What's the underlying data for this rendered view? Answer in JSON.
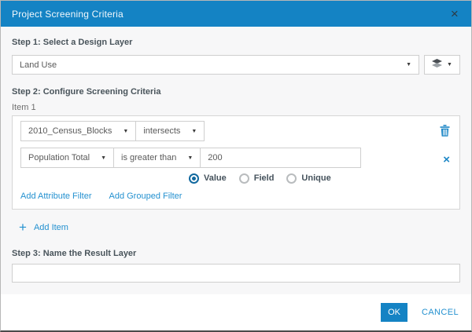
{
  "dialog": {
    "title": "Project Screening Criteria"
  },
  "icons": {
    "close": "×",
    "caret": "▼",
    "plus": "+",
    "remove": "×"
  },
  "step1": {
    "label": "Step 1: Select a Design Layer",
    "design_layer_value": "Land Use"
  },
  "step2": {
    "label": "Step 2: Configure Screening Criteria",
    "item_label": "Item 1",
    "expression": {
      "layer": "2010_Census_Blocks",
      "spatial_operator": "intersects"
    },
    "attribute_filter": {
      "field": "Population Total",
      "operator": "is greater than",
      "value": "200"
    },
    "value_type": {
      "options": [
        {
          "label": "Value",
          "selected": true
        },
        {
          "label": "Field",
          "selected": false
        },
        {
          "label": "Unique",
          "selected": false
        }
      ]
    },
    "add_attribute_filter_label": "Add Attribute Filter",
    "add_grouped_filter_label": "Add Grouped Filter",
    "add_item_label": "Add Item"
  },
  "step3": {
    "label": "Step 3: Name the Result Layer",
    "value": ""
  },
  "footer": {
    "ok_label": "OK",
    "cancel_label": "CANCEL"
  },
  "colors": {
    "header": "#1483c4",
    "accent": "#1483c4",
    "link": "#2491d0"
  }
}
